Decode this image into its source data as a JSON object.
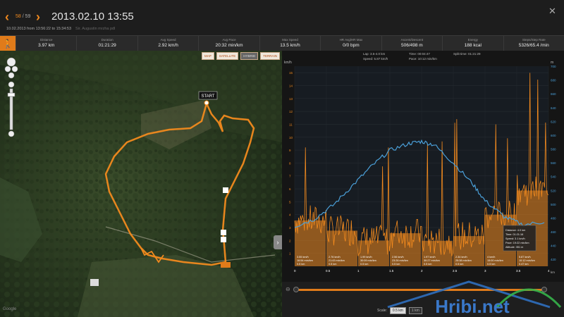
{
  "header": {
    "prev_icon": "‹",
    "next_icon": "›",
    "counter_current": "58",
    "counter_sep": "/",
    "counter_total": "59",
    "title": "2013.02.10 13:55",
    "subtitle": "10.02.2013 from 13:56:22 to 15:34:53",
    "user": "Sir. Augustin mrzha pdl",
    "close_icon": "✕"
  },
  "stats": [
    {
      "label": "Distance",
      "value": "3.97 km"
    },
    {
      "label": "Duration",
      "value": "01:21:29"
    },
    {
      "label": "Avg Speed",
      "value": "2.92 km/h"
    },
    {
      "label": "Avg Pace",
      "value": "20:32 min/km"
    },
    {
      "label": "Max Speed",
      "value": "13.5 km/h"
    },
    {
      "label": "HR Avg/HR Max",
      "value": "0/0 bpm"
    },
    {
      "label": "Ascent/Descent",
      "value": "506/498 m"
    },
    {
      "label": "Energy",
      "value": "188 kcal"
    },
    {
      "label": "Steps/Step Rate",
      "value": "5326/65.4 /min"
    }
  ],
  "activity_icon": "hiker-icon",
  "map": {
    "types": [
      "MAP",
      "SATELLITE",
      "HYBRID",
      "TERRAIN"
    ],
    "selected": "HYBRID",
    "start_label": "START",
    "logo": "Google",
    "expand_icon": "›"
  },
  "chart_info": {
    "lap": "Lap: 3.5-4.0 km",
    "speed": "Speed: 5.87 km/h",
    "time": "Time: 00:04:47",
    "pace": "Pace: 10:12 min/km",
    "split": "Split time: 01:21:29"
  },
  "chart_data": {
    "type": "area",
    "ylabel_left": "km/h",
    "ylabel_right": "m",
    "y_ticks": [
      "15",
      "14",
      "13",
      "12",
      "11",
      "10",
      "9",
      "8",
      "7",
      "6",
      "5",
      "4",
      "3",
      "2",
      "1"
    ],
    "right_ticks": [
      "700",
      "680",
      "660",
      "640",
      "620",
      "600",
      "580",
      "560",
      "540",
      "520",
      "500",
      "480",
      "460",
      "440",
      "420"
    ],
    "x_ticks": [
      "0",
      "0.5",
      "1",
      "1.5",
      "2",
      "2.5",
      "3",
      "3.5",
      "4"
    ],
    "xlabel": "km",
    "laps": [
      {
        "speed": 3.55,
        "pace": "16:54",
        "dist": "0.5 km"
      },
      {
        "speed": 2.76,
        "pace": "21:43",
        "dist": "0.5 km"
      },
      {
        "speed": 1.99,
        "pace": "30:09",
        "dist": "0.5 km"
      },
      {
        "speed": 2.56,
        "pace": "23:26",
        "dist": "0.5 km"
      },
      {
        "speed": 1.97,
        "pace": "30:27",
        "dist": "0.5 km"
      },
      {
        "speed": 2.34,
        "pace": "25:38",
        "dist": "0.5 km"
      },
      {
        "speed": 4.0,
        "pace": "15:00",
        "dist": "0.5 km"
      },
      {
        "speed": 5.87,
        "pace": "10:12",
        "dist": "0.47 km"
      }
    ],
    "lap_units": {
      "speed": "km/h",
      "pace": "min/km"
    },
    "altitude_profile": [
      [
        0,
        468
      ],
      [
        0.3,
        478
      ],
      [
        0.6,
        498
      ],
      [
        0.9,
        526
      ],
      [
        1.2,
        554
      ],
      [
        1.5,
        578
      ],
      [
        1.8,
        588
      ],
      [
        2.0,
        591
      ],
      [
        2.2,
        586
      ],
      [
        2.5,
        560
      ],
      [
        2.8,
        530
      ],
      [
        3.0,
        505
      ],
      [
        3.3,
        482
      ],
      [
        3.6,
        470
      ],
      [
        3.97,
        475
      ]
    ],
    "tooltip": {
      "distance": "Distance: 4.0 km",
      "time": "Time: 01:21:16",
      "speed": "Speed: 3.1 km/h",
      "pace": "Pace: 19:22 min/km",
      "altitude": "Altitude: 351 m"
    },
    "colors": {
      "speed": "#f28a1e",
      "altitude": "#4a9fd8"
    }
  },
  "scale": {
    "label": "Scale:",
    "options": [
      "0.5 km",
      "1 km"
    ],
    "selected": "0.5 km"
  },
  "watermark": "Hribi.net"
}
